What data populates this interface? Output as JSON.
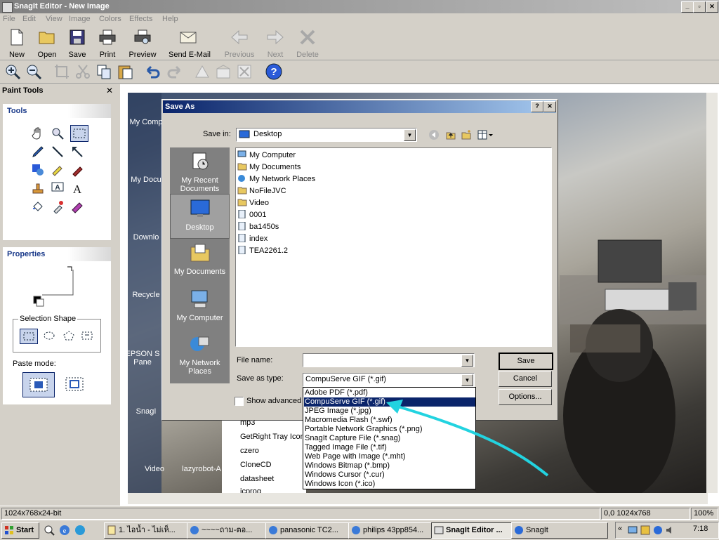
{
  "window": {
    "title": "SnagIt Editor - New Image"
  },
  "menu": [
    "File",
    "Edit",
    "View",
    "Image",
    "Colors",
    "Effects",
    "Help"
  ],
  "toolbar": {
    "buttons": [
      {
        "label": "New",
        "icon": "new-document-icon",
        "enabled": true
      },
      {
        "label": "Open",
        "icon": "folder-open-icon",
        "enabled": true
      },
      {
        "label": "Save",
        "icon": "floppy-disk-icon",
        "enabled": true
      },
      {
        "label": "Print",
        "icon": "printer-icon",
        "enabled": true
      },
      {
        "label": "Preview",
        "icon": "print-preview-icon",
        "enabled": true
      },
      {
        "label": "Send E-Mail",
        "icon": "envelope-icon",
        "enabled": true
      },
      {
        "label": "Previous",
        "icon": "arrow-left-icon",
        "enabled": false
      },
      {
        "label": "Next",
        "icon": "arrow-right-icon",
        "enabled": false
      },
      {
        "label": "Delete",
        "icon": "delete-x-icon",
        "enabled": false
      }
    ]
  },
  "left_panel": {
    "title": "Paint Tools",
    "close": "✕",
    "tools_heading": "Tools",
    "properties_heading": "Properties",
    "selection_shape_label": "Selection Shape",
    "paste_mode_label": "Paste mode:"
  },
  "desktop_icons": [
    "My Comp",
    "My Docu",
    "Downlo",
    "Recycle",
    "EPSON S Pane",
    "SnagI",
    "Video",
    "lazyrobot-A"
  ],
  "dialog": {
    "title": "Save As",
    "help": "?",
    "close": "✕",
    "save_in_label": "Save in:",
    "save_in_value": "Desktop",
    "places": [
      "My Recent Documents",
      "Desktop",
      "My Documents",
      "My Computer",
      "My Network Places"
    ],
    "files": [
      "My Computer",
      "My Documents",
      "My Network Places",
      "NoFileJVC",
      "Video",
      "0001",
      "ba1450s",
      "index",
      "TEA2261.2"
    ],
    "file_name_label": "File name:",
    "file_name_value": "",
    "save_as_type_label": "Save as type:",
    "save_as_type_value": "CompuServe GIF (*.gif)",
    "show_advanced": "Show advanced",
    "save_button": "Save",
    "cancel_button": "Cancel",
    "options_button": "Options...",
    "file_types": [
      "Adobe PDF (*.pdf)",
      "CompuServe GIF (*.gif)",
      "JPEG Image (*.jpg)",
      "Macromedia Flash (*.swf)",
      "Portable Network Graphics (*.png)",
      "SnagIt Capture File (*.snag)",
      "Tagged Image File (*.tif)",
      "Web Page with Image (*.mht)",
      "Windows Bitmap (*.bmp)",
      "Windows Cursor (*.cur)",
      "Windows Icon (*.ico)"
    ],
    "selected_type_index": 1
  },
  "background_list": [
    "mp3",
    "GetRight Tray Icon",
    "czero",
    "CloneCD",
    "datasheet",
    "icprog"
  ],
  "status": {
    "image_info": "1024x768x24-bit",
    "coords": "0,0  1024x768",
    "zoom": "100%"
  },
  "taskbar": {
    "start": "Start",
    "tasks": [
      "1. ไอน้ำ - ไม่เห็...",
      "~~~~ถาม-ตอ...",
      "panasonic TC2...",
      "philips 43pp854...",
      "SnagIt Editor ...",
      "SnagIt"
    ],
    "active_task_index": 4,
    "clock": "7:18"
  },
  "colors": {
    "dialog_title": "#0a246a",
    "selection": "#0a246a",
    "arrow": "#22d3e0"
  }
}
